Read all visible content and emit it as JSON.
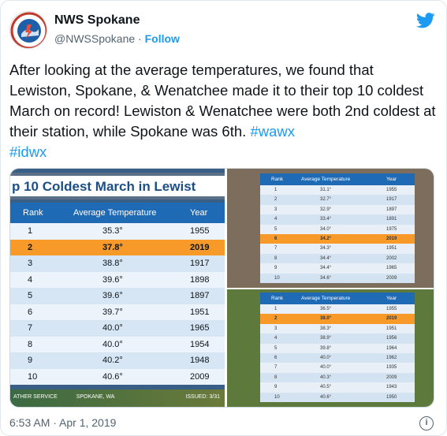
{
  "account": {
    "name": "NWS Spokane",
    "handle": "@NWSSpokane",
    "separator": "·",
    "follow_label": "Follow"
  },
  "tweet": {
    "text": "After looking at the average temperatures, we found that Lewiston, Spokane, & Wenatchee made it to their top 10 coldest March on record! Lewiston & Wenatchee were both 2nd coldest at their station, while Spokane was 6th.",
    "hashtags": [
      "#wawx",
      "#idwx"
    ]
  },
  "image_left": {
    "banner": "p 10 Coldest March in Lewist",
    "headers": [
      "Rank",
      "Average Temperature",
      "Year"
    ],
    "rows": [
      {
        "rank": "1",
        "temp": "35.3°",
        "year": "1955"
      },
      {
        "rank": "2",
        "temp": "37.8°",
        "year": "2019"
      },
      {
        "rank": "3",
        "temp": "38.8°",
        "year": "1917"
      },
      {
        "rank": "4",
        "temp": "39.6°",
        "year": "1898"
      },
      {
        "rank": "5",
        "temp": "39.6°",
        "year": "1897"
      },
      {
        "rank": "6",
        "temp": "39.7°",
        "year": "1951"
      },
      {
        "rank": "7",
        "temp": "40.0°",
        "year": "1965"
      },
      {
        "rank": "8",
        "temp": "40.0°",
        "year": "1954"
      },
      {
        "rank": "9",
        "temp": "40.2°",
        "year": "1948"
      },
      {
        "rank": "10",
        "temp": "40.6°",
        "year": "2009"
      }
    ],
    "footer_left": "ATHER SERVICE",
    "footer_mid": "SPOKANE, WA",
    "footer_right": "ISSUED: 3/31"
  },
  "image_top_right": {
    "headers": [
      "Rank",
      "Average Temperature",
      "Year"
    ],
    "rows": [
      {
        "rank": "1",
        "temp": "31.1°",
        "year": "1955"
      },
      {
        "rank": "2",
        "temp": "32.7°",
        "year": "1917"
      },
      {
        "rank": "3",
        "temp": "32.9°",
        "year": "1897"
      },
      {
        "rank": "4",
        "temp": "33.4°",
        "year": "1891"
      },
      {
        "rank": "5",
        "temp": "34.0°",
        "year": "1975"
      },
      {
        "rank": "6",
        "temp": "34.2°",
        "year": "2019"
      },
      {
        "rank": "7",
        "temp": "34.3°",
        "year": "1951"
      },
      {
        "rank": "8",
        "temp": "34.4°",
        "year": "2002"
      },
      {
        "rank": "9",
        "temp": "34.4°",
        "year": "1965"
      },
      {
        "rank": "10",
        "temp": "34.6°",
        "year": "2009"
      }
    ]
  },
  "image_bottom_right": {
    "headers": [
      "Rank",
      "Average Temperature",
      "Year"
    ],
    "rows": [
      {
        "rank": "1",
        "temp": "36.5°",
        "year": "1955"
      },
      {
        "rank": "2",
        "temp": "38.0°",
        "year": "2019"
      },
      {
        "rank": "3",
        "temp": "38.3°",
        "year": "1951"
      },
      {
        "rank": "4",
        "temp": "38.9°",
        "year": "1956"
      },
      {
        "rank": "5",
        "temp": "39.8°",
        "year": "1964"
      },
      {
        "rank": "6",
        "temp": "40.0°",
        "year": "1962"
      },
      {
        "rank": "7",
        "temp": "40.0°",
        "year": "1935"
      },
      {
        "rank": "8",
        "temp": "40.3°",
        "year": "2009"
      },
      {
        "rank": "9",
        "temp": "40.5°",
        "year": "1943"
      },
      {
        "rank": "10",
        "temp": "40.6°",
        "year": "1950"
      }
    ]
  },
  "meta": {
    "timestamp": "6:53 AM · Apr 1, 2019"
  },
  "colors": {
    "accent": "#1d9bf0",
    "highlight": "#f79a2a",
    "table_header": "#1f6ab5"
  }
}
